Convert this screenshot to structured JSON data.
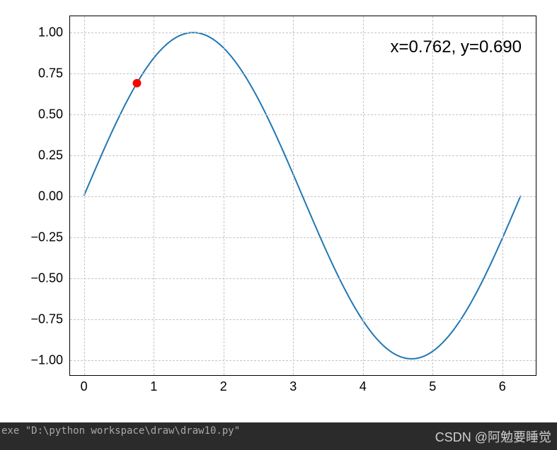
{
  "chart_data": {
    "type": "line",
    "x_range": [
      0,
      6.2832
    ],
    "series": [
      {
        "name": "sin(x)",
        "function": "sin",
        "color": "#1f77b4"
      }
    ],
    "marker": {
      "x": 0.762,
      "y": 0.69,
      "color": "#ff0000",
      "size": 6
    },
    "annotation_text": "x=0.762, y=0.690",
    "xlim": [
      -0.2,
      6.5
    ],
    "ylim": [
      -1.1,
      1.1
    ],
    "x_ticks": [
      0,
      1,
      2,
      3,
      4,
      5,
      6
    ],
    "y_ticks": [
      -1.0,
      -0.75,
      -0.5,
      -0.25,
      0.0,
      0.25,
      0.5,
      0.75,
      1.0
    ],
    "x_tick_labels": [
      "0",
      "1",
      "2",
      "3",
      "4",
      "5",
      "6"
    ],
    "y_tick_labels": [
      "−1.00",
      "−0.75",
      "−0.50",
      "−0.25",
      "0.00",
      "0.25",
      "0.50",
      "0.75",
      "1.00"
    ],
    "grid": true
  },
  "terminal": {
    "line1": "exe  \"D:\\python workspace\\draw\\draw10.py\""
  },
  "watermark": "CSDN @阿勉要睡觉"
}
